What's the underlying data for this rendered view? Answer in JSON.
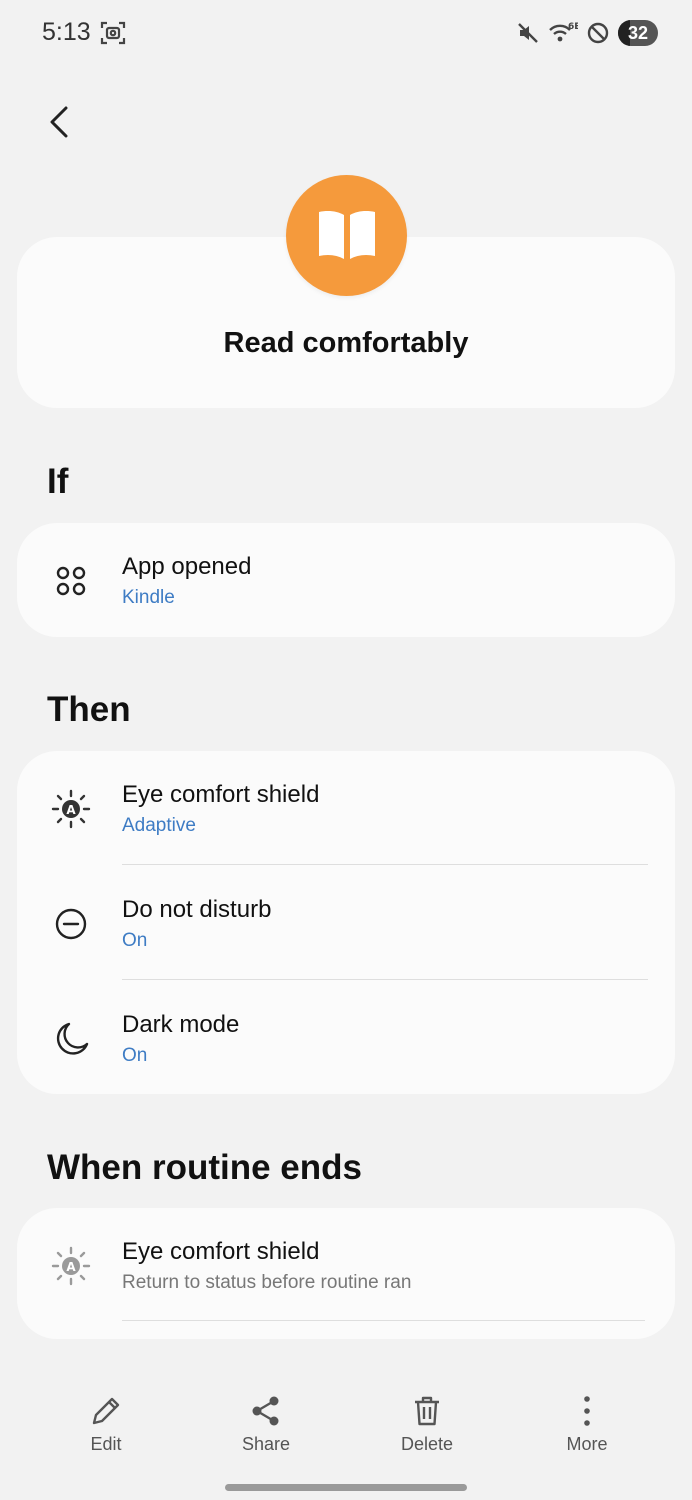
{
  "status_bar": {
    "time": "5:13",
    "battery": "32",
    "icons": [
      "screenshot-icon",
      "mute-icon",
      "wifi-6e-icon",
      "do-not-disturb-status-icon",
      "battery-icon"
    ]
  },
  "header": {
    "routine_title": "Read comfortably",
    "icon": "book-open-icon",
    "icon_color": "#f59a3c"
  },
  "if_section": {
    "heading": "If",
    "items": [
      {
        "icon": "apps-icon",
        "title": "App opened",
        "subtitle": "Kindle"
      }
    ]
  },
  "then_section": {
    "heading": "Then",
    "items": [
      {
        "icon": "eye-comfort-icon",
        "title": "Eye comfort shield",
        "subtitle": "Adaptive"
      },
      {
        "icon": "do-not-disturb-icon",
        "title": "Do not disturb",
        "subtitle": "On"
      },
      {
        "icon": "dark-mode-icon",
        "title": "Dark mode",
        "subtitle": "On"
      }
    ]
  },
  "ends_section": {
    "heading": "When routine ends",
    "items": [
      {
        "icon": "eye-comfort-icon",
        "title": "Eye comfort shield",
        "subtitle": "Return to status before routine ran"
      }
    ]
  },
  "bottom_bar": {
    "edit": "Edit",
    "share": "Share",
    "delete": "Delete",
    "more": "More"
  },
  "colors": {
    "accent_blue": "#3e7cc4",
    "background": "#f2f2f2",
    "card": "#fbfbfb"
  }
}
